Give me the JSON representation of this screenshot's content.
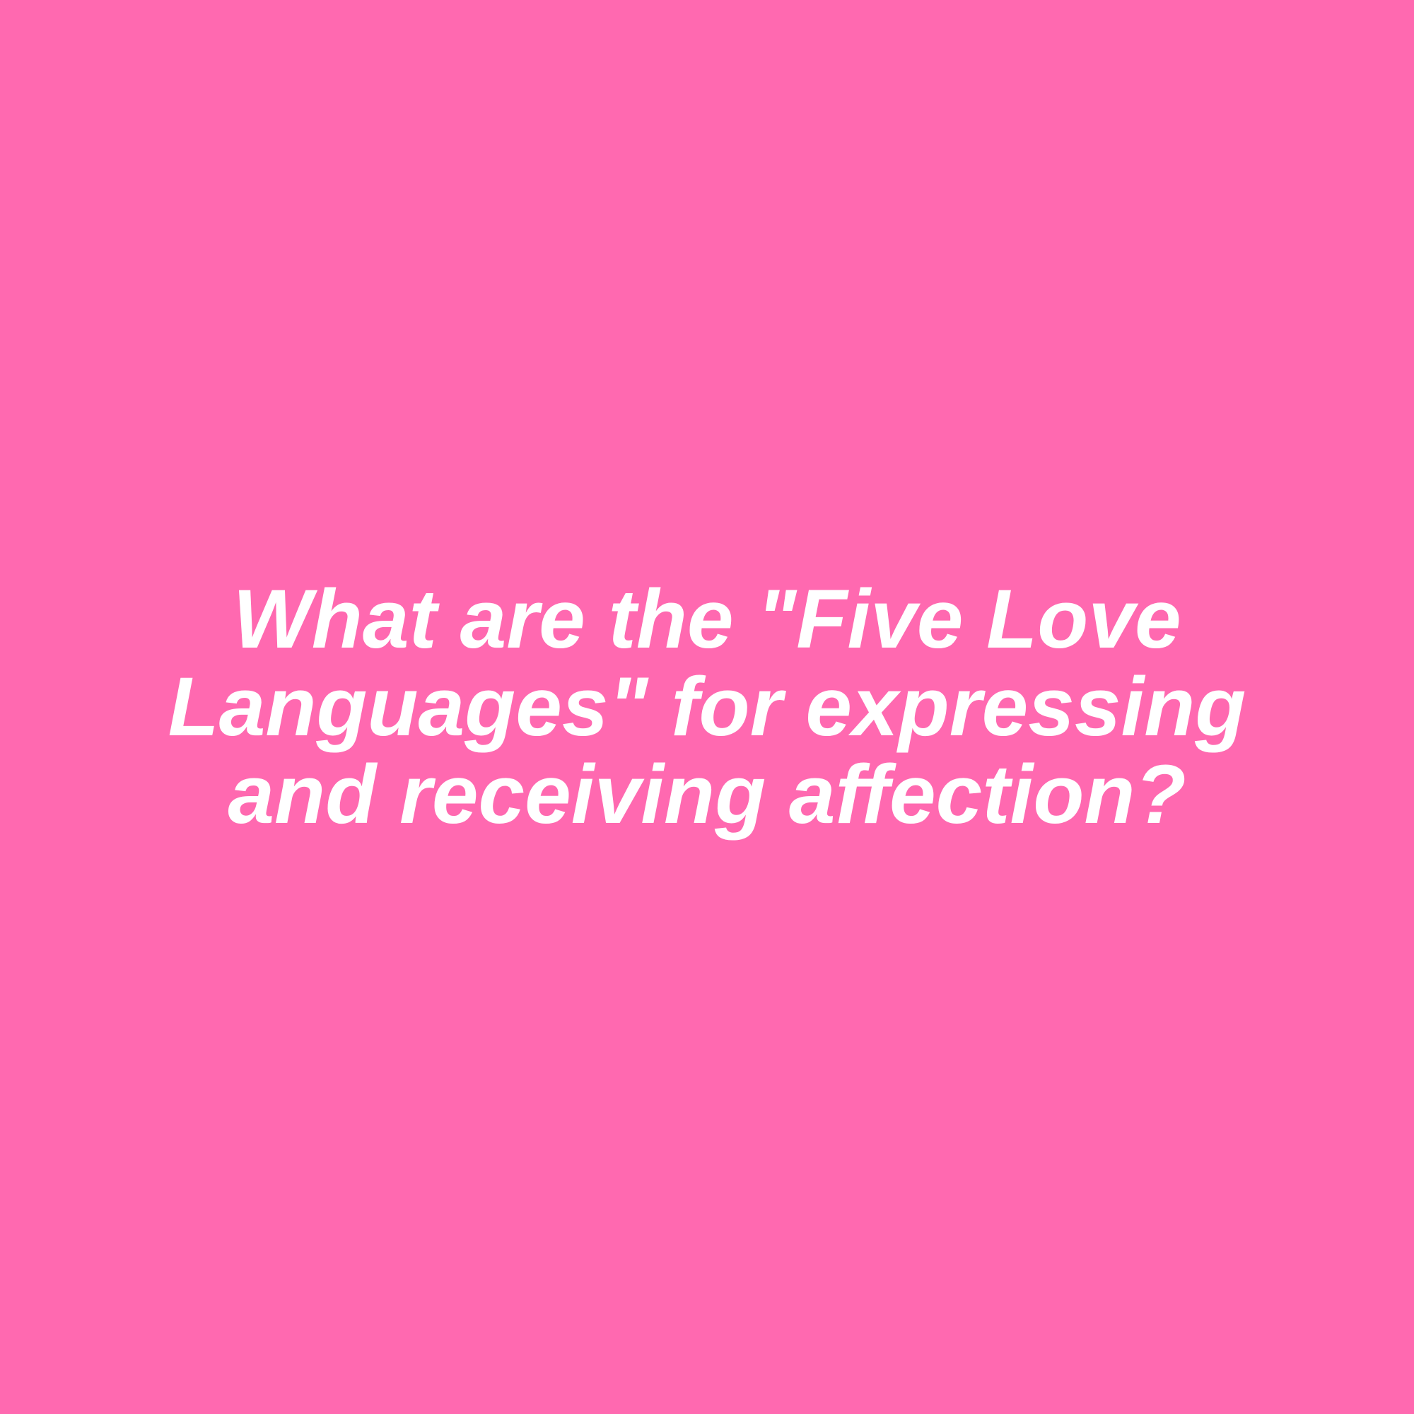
{
  "background_color": "#ff69b0",
  "text_color": "#ffffff",
  "question": {
    "line1": "What are the \"Five Love",
    "line2": "Languages\" for expressing",
    "line3": "and receiving affection?"
  }
}
